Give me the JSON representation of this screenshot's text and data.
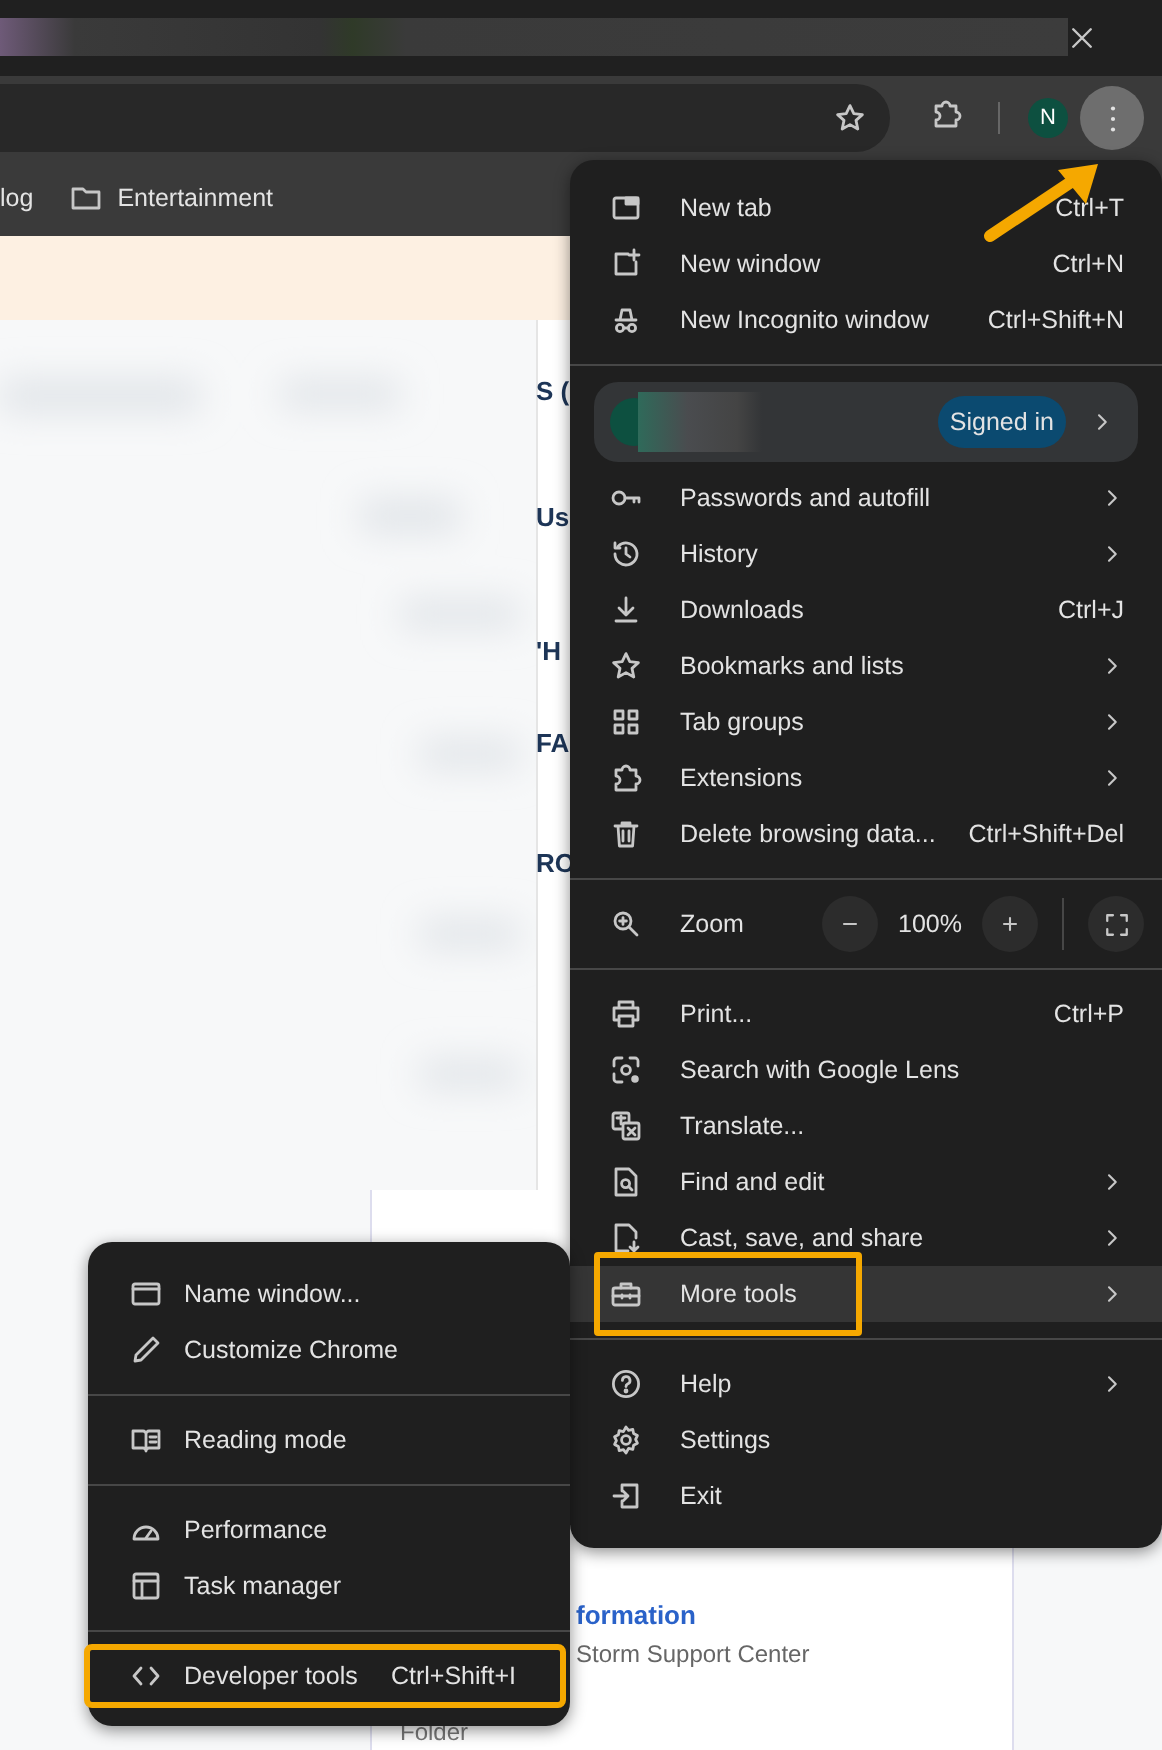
{
  "toolbar": {
    "avatar": "N"
  },
  "bookmarks_bar": {
    "items": [
      {
        "kind": "cut",
        "label": "log"
      },
      {
        "kind": "folder",
        "label": "Entertainment"
      }
    ]
  },
  "page": {
    "fragments": [
      "S (",
      "Us",
      "'H",
      "FA",
      "RO"
    ],
    "link": "formation",
    "subtitle": "Storm Support Center",
    "footer": "Folder"
  },
  "main_menu": {
    "sections": [
      [
        {
          "kind": "item",
          "label": "New tab",
          "shortcut": "Ctrl+T",
          "submenu": false,
          "expanded": false,
          "highlighted": false
        },
        {
          "kind": "item",
          "label": "New window",
          "shortcut": "Ctrl+N",
          "submenu": false,
          "expanded": false,
          "highlighted": false
        },
        {
          "kind": "item",
          "label": "New Incognito window",
          "shortcut": "Ctrl+Shift+N",
          "submenu": false,
          "expanded": false,
          "highlighted": false
        }
      ],
      [
        {
          "kind": "profile",
          "badge": "Signed in",
          "submenu": true
        },
        {
          "kind": "item",
          "label": "Passwords and autofill",
          "submenu": true,
          "expanded": false,
          "highlighted": false
        },
        {
          "kind": "item",
          "label": "History",
          "submenu": true,
          "expanded": false,
          "highlighted": false
        },
        {
          "kind": "item",
          "label": "Downloads",
          "shortcut": "Ctrl+J",
          "submenu": false,
          "expanded": false,
          "highlighted": false
        },
        {
          "kind": "item",
          "label": "Bookmarks and lists",
          "submenu": true,
          "expanded": false,
          "highlighted": false
        },
        {
          "kind": "item",
          "label": "Tab groups",
          "submenu": true,
          "expanded": false,
          "highlighted": false
        },
        {
          "kind": "item",
          "label": "Extensions",
          "submenu": true,
          "expanded": false,
          "highlighted": false
        },
        {
          "kind": "item",
          "label": "Delete browsing data...",
          "shortcut": "Ctrl+Shift+Del",
          "submenu": false,
          "expanded": false,
          "highlighted": false
        }
      ],
      [
        {
          "kind": "zoom",
          "label": "Zoom",
          "value": "100%"
        }
      ],
      [
        {
          "kind": "item",
          "label": "Print...",
          "shortcut": "Ctrl+P",
          "submenu": false,
          "expanded": false,
          "highlighted": false
        },
        {
          "kind": "item",
          "label": "Search with Google Lens",
          "submenu": false,
          "expanded": false,
          "highlighted": false
        },
        {
          "kind": "item",
          "label": "Translate...",
          "submenu": false,
          "expanded": false,
          "highlighted": false
        },
        {
          "kind": "item",
          "label": "Find and edit",
          "submenu": true,
          "expanded": false,
          "highlighted": false
        },
        {
          "kind": "item",
          "label": "Cast, save, and share",
          "submenu": true,
          "expanded": false,
          "highlighted": false
        },
        {
          "kind": "item",
          "label": "More tools",
          "submenu": true,
          "expanded": true,
          "highlighted": true
        }
      ],
      [
        {
          "kind": "item",
          "label": "Help",
          "submenu": true,
          "expanded": false,
          "highlighted": false
        },
        {
          "kind": "item",
          "label": "Settings",
          "submenu": false,
          "expanded": false,
          "highlighted": false
        },
        {
          "kind": "item",
          "label": "Exit",
          "submenu": false,
          "expanded": false,
          "highlighted": false
        }
      ]
    ]
  },
  "more_tools_menu": {
    "sections": [
      [
        {
          "kind": "item",
          "label": "Name window...",
          "highlighted": false
        },
        {
          "kind": "item",
          "label": "Customize Chrome",
          "highlighted": false
        }
      ],
      [
        {
          "kind": "item",
          "label": "Reading mode",
          "highlighted": false
        }
      ],
      [
        {
          "kind": "item",
          "label": "Performance",
          "highlighted": false
        },
        {
          "kind": "item",
          "label": "Task manager",
          "highlighted": false
        }
      ],
      [
        {
          "kind": "item",
          "label": "Developer tools",
          "shortcut": "Ctrl+Shift+I",
          "highlighted": true
        }
      ]
    ]
  }
}
